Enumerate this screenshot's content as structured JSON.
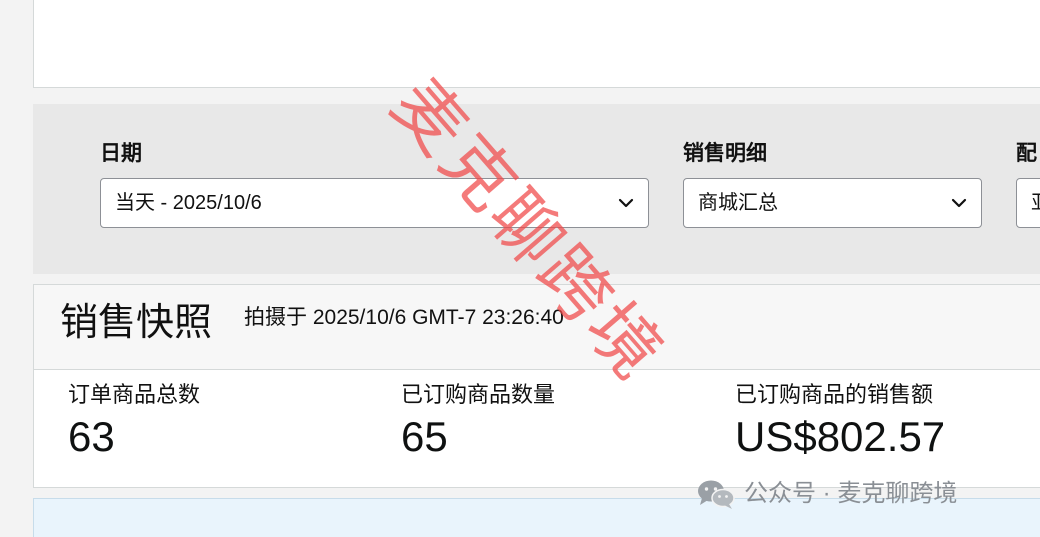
{
  "filters": {
    "date": {
      "label": "日期",
      "value": "当天 - 2025/10/6"
    },
    "sales_breakdown": {
      "label": "销售明细",
      "value": "商城汇总"
    },
    "fulfillment": {
      "label": "配",
      "value": "亚"
    }
  },
  "snapshot": {
    "title": "销售快照",
    "timestamp": "拍摄于 2025/10/6 GMT-7 23:26:40",
    "metrics": [
      {
        "label": "订单商品总数",
        "value": "63"
      },
      {
        "label": "已订购商品数量",
        "value": "65"
      },
      {
        "label": "已订购商品的销售额",
        "value": "US$802.57"
      }
    ]
  },
  "watermark": {
    "text": "麦克聊跨境",
    "color": "#f04646"
  },
  "wechat_badge": {
    "icon": "wechat-icon",
    "text": "公众号 · 麦克聊跨境"
  },
  "colors": {
    "filter_bar_bg": "#e8e8e8",
    "panel_border": "#d5d9d9",
    "bottom_panel_bg": "#e9f4fc"
  }
}
